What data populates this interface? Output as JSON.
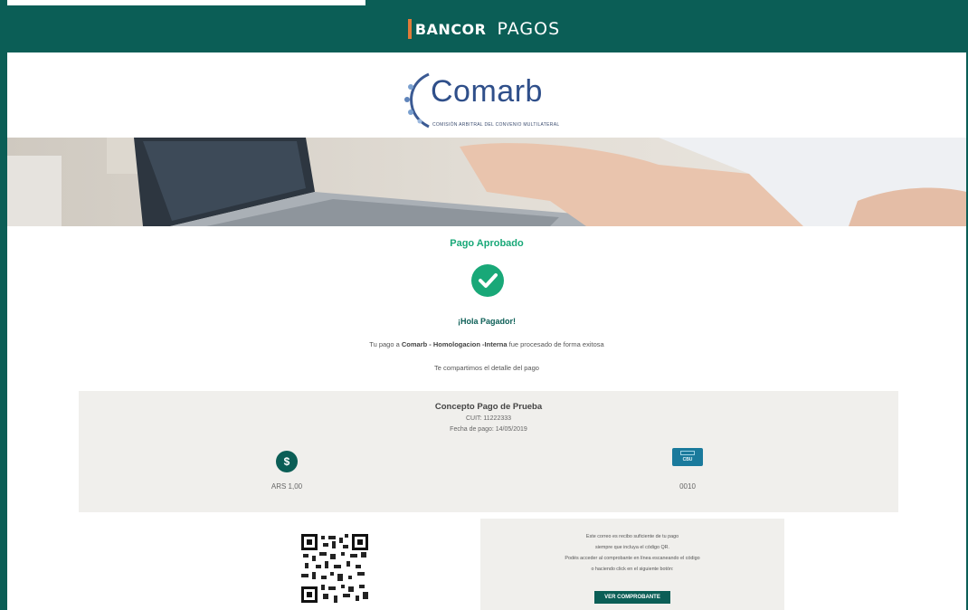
{
  "header": {
    "brand_bancor": "BANCOR",
    "brand_pagos": "PAGOS"
  },
  "logo": {
    "name": "Comarb",
    "subtitle": "COMISIÓN ARBITRAL DEL CONVENIO MULTILATERAL"
  },
  "status": {
    "title": "Pago Aprobado",
    "icon": "check-circle-icon"
  },
  "greeting": "¡Hola Pagador!",
  "message": {
    "prefix": "Tu pago a ",
    "merchant": "Comarb - Homologacion -Interna",
    "suffix": " fue procesado de forma exitosa"
  },
  "detail_intro": "Te compartimos el detalle del pago",
  "payment": {
    "concept": "Concepto Pago de Prueba",
    "cuit": "CUIT: 11222333",
    "date": "Fecha de pago: 14/05/2019",
    "currency_icon": "$",
    "amount": "ARS 1,00",
    "method_icon_label": "CBU",
    "method_value": "0010"
  },
  "receipt": {
    "line1": "Este correo es recibo suficiente de tu pago",
    "line2": "siempre que incluya el código QR.",
    "line3": "Podés acceder al comprobante en línea escaneando el código",
    "line4": "o haciendo click en el siguiente botón:",
    "button_label": "VER COMPROBANTE"
  },
  "colors": {
    "brand": "#0b5e56",
    "success": "#19a878",
    "accent": "#e07b39"
  }
}
